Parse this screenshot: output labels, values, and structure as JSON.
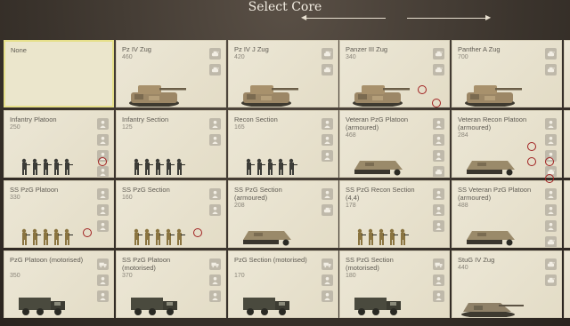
{
  "header": {
    "title": "Select Core"
  },
  "colors": {
    "cell_bg": "#e9e4d1",
    "selected_border": "#e6e08a",
    "slot_bg": "#bfb9aa",
    "highlight_ring": "#a02020",
    "tank": "#8a7a5a",
    "truck": "#4a4a3e"
  },
  "cells": [
    {
      "name": "None",
      "cost": ""
    },
    {
      "name": "Pz IV Zug",
      "cost": "460"
    },
    {
      "name": "Pz IV J Zug",
      "cost": "420"
    },
    {
      "name": "Panzer III Zug",
      "cost": "340"
    },
    {
      "name": "Panther A Zug",
      "cost": "700"
    },
    {
      "name": "Infantry Platoon",
      "cost": "250"
    },
    {
      "name": "Infantry Section",
      "cost": "125"
    },
    {
      "name": "Recon Section",
      "cost": "165"
    },
    {
      "name": "Veteran PzG Platoon (armoured)",
      "cost": "468"
    },
    {
      "name": "Veteran Recon Platoon (armoured)",
      "cost": "284"
    },
    {
      "name": "SS PzG Platoon",
      "cost": "330"
    },
    {
      "name": "SS PzG Section",
      "cost": "160"
    },
    {
      "name": "SS PzG Section (armoured)",
      "cost": "208"
    },
    {
      "name": "SS PzG Recon Section (4,4)",
      "cost": "178"
    },
    {
      "name": "SS Veteran PzG Platoon (armoured)",
      "cost": "488"
    },
    {
      "name": "PzG Platoon (motorised)",
      "cost": "350"
    },
    {
      "name": "SS PzG Platoon (motorised)",
      "cost": "370"
    },
    {
      "name": "PzG Section (motorised)",
      "cost": "170"
    },
    {
      "name": "SS PzG Section (motorised)",
      "cost": "180"
    },
    {
      "name": "StuG IV Zug",
      "cost": "440"
    }
  ]
}
